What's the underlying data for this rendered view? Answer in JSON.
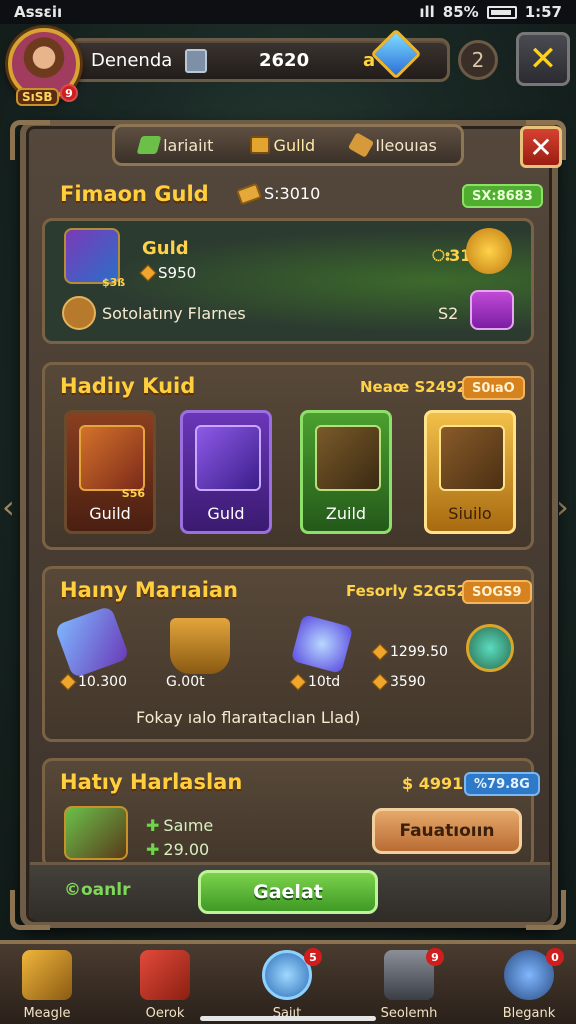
{
  "status": {
    "left": "Assɛiı",
    "signal": "ıll",
    "battery": "85%",
    "time": "1:57"
  },
  "player": {
    "name": "Denenda",
    "level": "SıSB",
    "notif": "9",
    "score": "2620",
    "gem_label": "a"
  },
  "top": {
    "token_label": "2",
    "close_label": "✕"
  },
  "tabs": [
    {
      "label": "lariaiıt",
      "icon": "leaf-icon"
    },
    {
      "label": "Gulld",
      "icon": "shield-icon"
    },
    {
      "label": "Ileouıas",
      "icon": "sword-icon"
    }
  ],
  "panel_close": "✕",
  "section1": {
    "title": "Fimaon Guld",
    "coins": "S:3010",
    "badge": "SX:8683",
    "item_title": "Guld",
    "item_value": "S950",
    "item_sub": "$3ß",
    "right_val1": "ഃ31",
    "right_val2": "S2",
    "footer_text": "Sotolatıny Flarnes"
  },
  "section2": {
    "title": "Hadiıy Kuid",
    "meta": "Neaœ S24925",
    "badge": "S0ıaO",
    "cards": [
      {
        "label": "Guild",
        "num": "S56",
        "color": "#8a3f1f"
      },
      {
        "label": "Guld",
        "num": "",
        "color": "#5a2a9a"
      },
      {
        "label": "Zuild",
        "num": "",
        "color": "#3f8a2a"
      },
      {
        "label": "Siuilo",
        "num": "",
        "color": "#c89020"
      }
    ]
  },
  "section3": {
    "title": "Haıny Marıaian",
    "meta": "Fesorly S2G528",
    "badge": "SOGS9",
    "loot": [
      {
        "value": "10.300"
      },
      {
        "value": "G.00t"
      },
      {
        "value": "10td"
      },
      {
        "value": "1299.50"
      },
      {
        "value": "3590"
      }
    ],
    "footer_text": "Fokay ıalo flaraıtaclıan Llad)"
  },
  "section4": {
    "title": "Hatıy Harlaslan",
    "price": "$ 49916",
    "badge": "%79.8G",
    "line1": "Saıme",
    "line2": "29.00",
    "side_button": "Fauatıoıın"
  },
  "actions": {
    "cost_label": "©oanlr",
    "primary_button": "Gaelat"
  },
  "bottomnav": [
    {
      "label": "Meagle",
      "badge": "",
      "color": "#d99a30"
    },
    {
      "label": "Oerok",
      "badge": "",
      "color": "#c0392b"
    },
    {
      "label": "Saiıt",
      "badge": "5",
      "color": "#2d8fd6"
    },
    {
      "label": "Seolemh",
      "badge": "9",
      "color": "#6b6f78"
    },
    {
      "label": "Blegank",
      "badge": "0",
      "color": "#3b6fb0"
    }
  ]
}
